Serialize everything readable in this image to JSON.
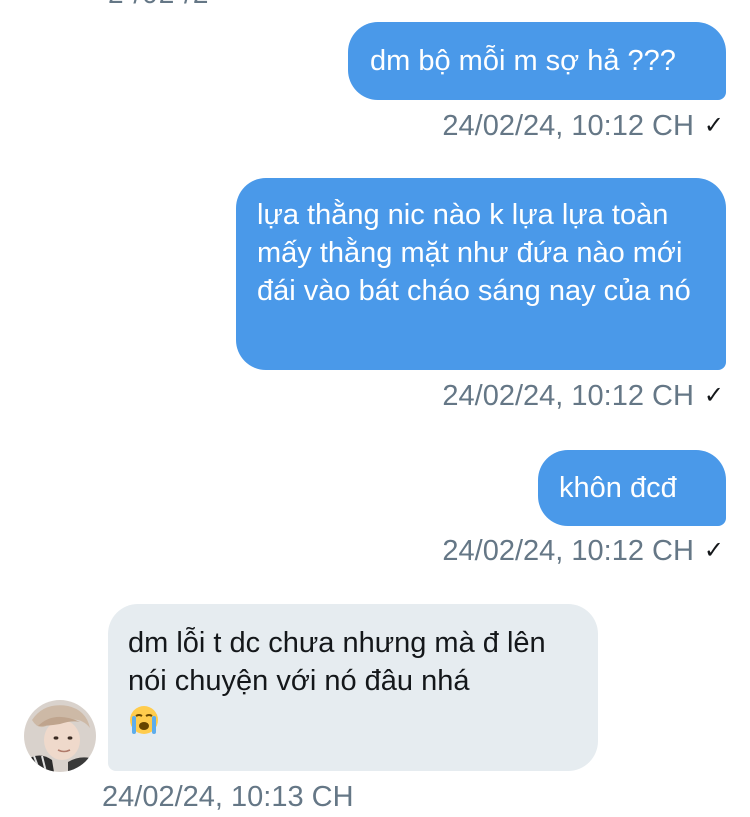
{
  "top_fragment": "2 /02 /2",
  "messages": [
    {
      "direction": "out",
      "text": "dm bộ mỗi m sợ hả ???",
      "meta": "24/02/24, 10:12 CH",
      "status_icon": "✓"
    },
    {
      "direction": "out",
      "text": "lựa thằng nic nào k lựa lựa toàn mấy thằng mặt như đứa nào mới đái vào bát cháo sáng nay của nó",
      "meta": "24/02/24, 10:12 CH",
      "status_icon": "✓"
    },
    {
      "direction": "out",
      "text": "khôn đcđ",
      "meta": "24/02/24, 10:12 CH",
      "status_icon": "✓"
    },
    {
      "direction": "in",
      "text": "dm lỗi t dc chưa nhưng mà đ lên nói chuyện với nó đâu nhá",
      "emoji": "crying-face-emoji",
      "meta": "24/02/24, 10:13 CH"
    }
  ],
  "colors": {
    "outgoing_bubble": "#4a99e9",
    "incoming_bubble": "#e6ecf0",
    "timestamp": "#657786"
  }
}
